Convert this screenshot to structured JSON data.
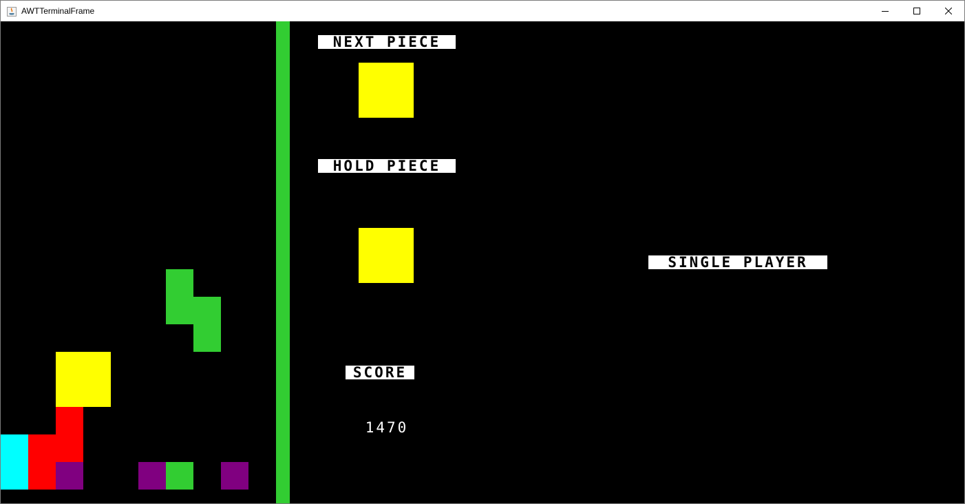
{
  "window": {
    "title": "AWTTerminalFrame",
    "minimize": "minimize",
    "maximize": "maximize",
    "close": "close"
  },
  "colors": {
    "cyan": "#00ffff",
    "red": "#ff0000",
    "purple": "#800080",
    "green": "#32cd32",
    "yellow": "#ffff00",
    "background": "#000000",
    "divider": "#32cd32"
  },
  "board": {
    "locked_blocks": [
      {
        "col": 0,
        "row": 15,
        "color": "cyan"
      },
      {
        "col": 0,
        "row": 16,
        "color": "cyan"
      },
      {
        "col": 1,
        "row": 15,
        "color": "red"
      },
      {
        "col": 1,
        "row": 16,
        "color": "red"
      },
      {
        "col": 2,
        "row": 14,
        "color": "red"
      },
      {
        "col": 2,
        "row": 15,
        "color": "red"
      },
      {
        "col": 2,
        "row": 16,
        "color": "purple"
      },
      {
        "col": 5,
        "row": 16,
        "color": "purple"
      },
      {
        "col": 6,
        "row": 16,
        "color": "green"
      },
      {
        "col": 8,
        "row": 16,
        "color": "purple"
      },
      {
        "col": 2,
        "row": 12,
        "color": "yellow"
      },
      {
        "col": 3,
        "row": 12,
        "color": "yellow"
      },
      {
        "col": 2,
        "row": 13,
        "color": "yellow"
      },
      {
        "col": 3,
        "row": 13,
        "color": "yellow"
      }
    ],
    "falling_piece": {
      "color": "green",
      "cells": [
        {
          "col": 6,
          "row": 9
        },
        {
          "col": 6,
          "row": 10
        },
        {
          "col": 7,
          "row": 10
        },
        {
          "col": 7,
          "row": 11
        }
      ]
    }
  },
  "side_panel": {
    "next_label": "NEXT PIECE",
    "next_piece_color": "yellow",
    "hold_label": "HOLD PIECE",
    "hold_piece_color": "yellow",
    "score_label": "SCORE",
    "score_value": "1470",
    "mode_label": "SINGLE PLAYER"
  }
}
